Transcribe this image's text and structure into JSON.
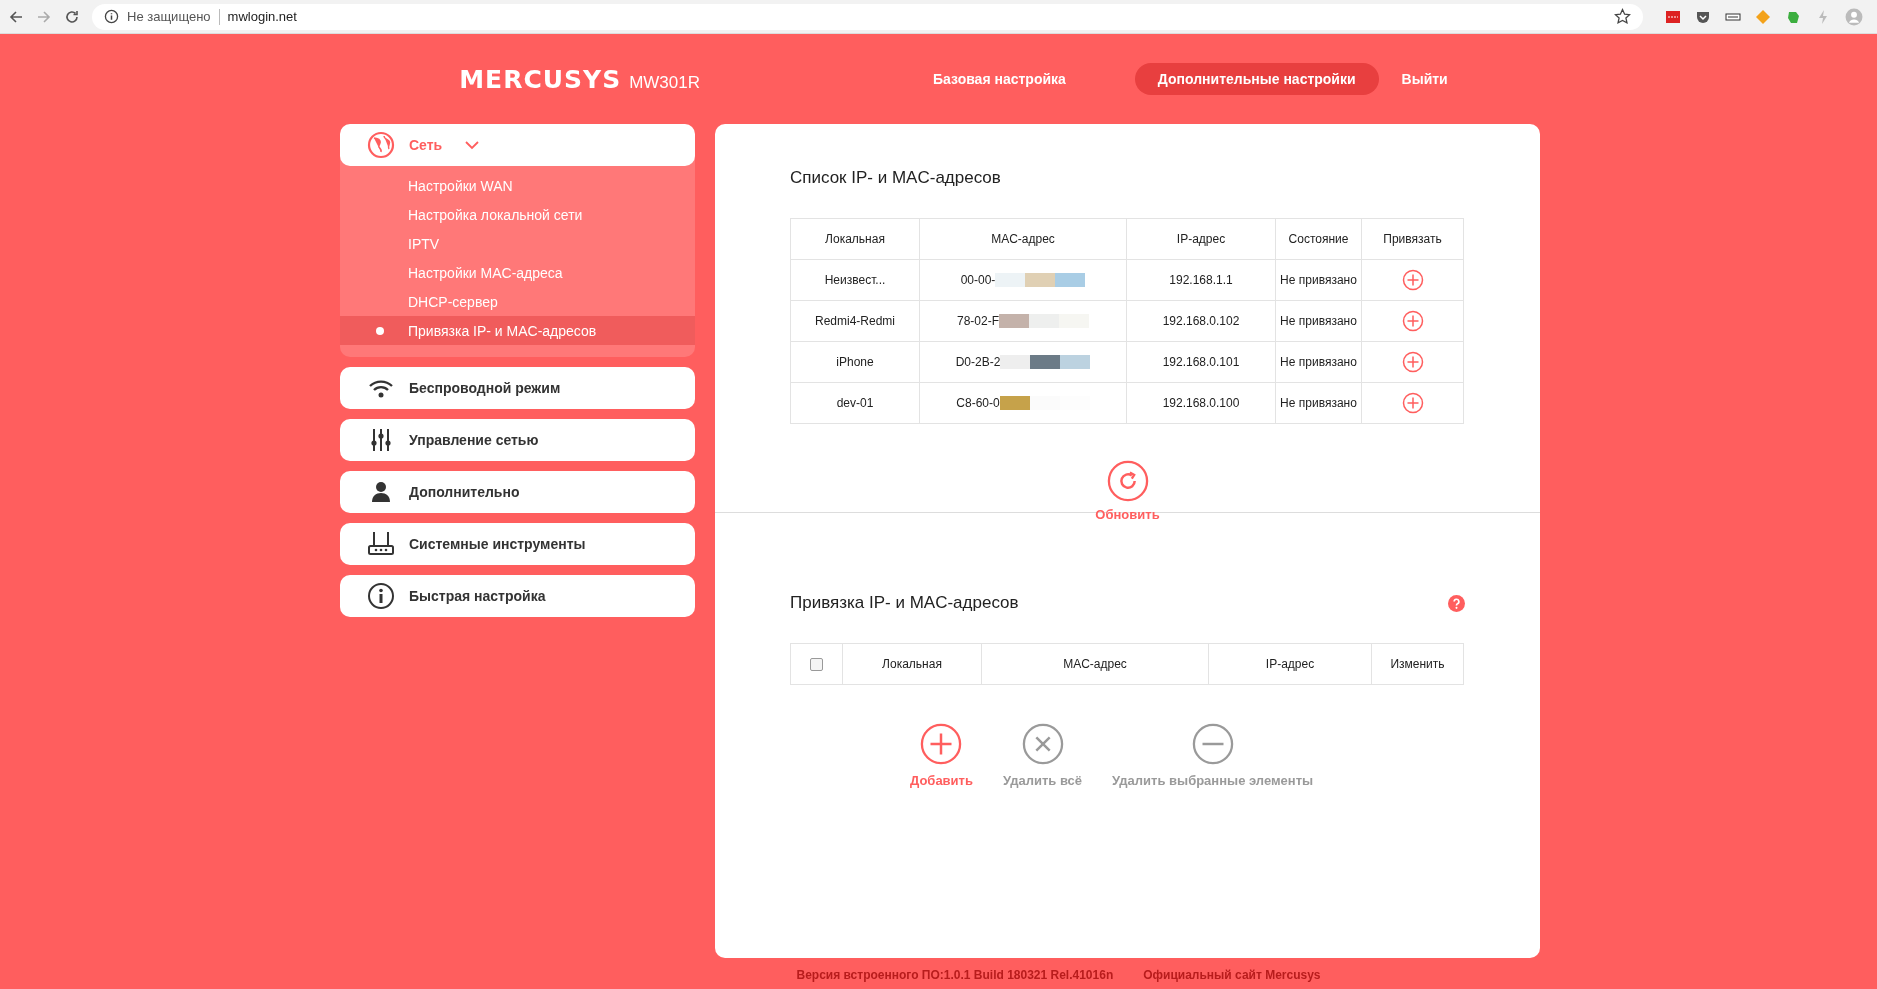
{
  "browser": {
    "security": "Не защищено",
    "url": "mwlogin.net"
  },
  "header": {
    "logo": "MERCUSYS",
    "model": "MW301R",
    "nav": [
      {
        "label": "Базовая настройка",
        "selected": false
      },
      {
        "label": "Дополнительные настройки",
        "selected": true
      },
      {
        "label": "Выйти",
        "selected": false
      }
    ]
  },
  "sidebar": {
    "items": [
      {
        "label": "Сеть",
        "expanded": true,
        "children": [
          {
            "label": "Настройки WAN",
            "selected": false
          },
          {
            "label": "Настройка локальной сети",
            "selected": false
          },
          {
            "label": "IPTV",
            "selected": false
          },
          {
            "label": "Настройки MAC-адреса",
            "selected": false
          },
          {
            "label": "DHCP-сервер",
            "selected": false
          },
          {
            "label": "Привязка IP- и MAC-адресов",
            "selected": true
          }
        ]
      },
      {
        "label": "Беспроводной режим",
        "expanded": false
      },
      {
        "label": "Управление сетью",
        "expanded": false
      },
      {
        "label": "Дополнительно",
        "expanded": false
      },
      {
        "label": "Системные инструменты",
        "expanded": false
      },
      {
        "label": "Быстрая настройка",
        "expanded": false
      }
    ]
  },
  "arp_list": {
    "title": "Список IP- и MAC-адресов",
    "columns": [
      "Локальная",
      "MAC-адрес",
      "IP-адрес",
      "Состояние",
      "Привязать"
    ],
    "rows": [
      {
        "name": "Неизвест...",
        "mac": "00-00-",
        "ip": "192.168.1.1",
        "status": "Не привязано"
      },
      {
        "name": "Redmi4-Redmi",
        "mac": "78-02-F",
        "ip": "192.168.0.102",
        "status": "Не привязано"
      },
      {
        "name": "iPhone",
        "mac": "D0-2B-2",
        "ip": "192.168.0.101",
        "status": "Не привязано"
      },
      {
        "name": "dev-01",
        "mac": "C8-60-0",
        "ip": "192.168.0.100",
        "status": "Не привязано"
      }
    ],
    "refresh": "Обновить"
  },
  "binding": {
    "title": "Привязка IP- и MAC-адресов",
    "select_all_checked": false,
    "columns": [
      "Локальная",
      "MAC-адрес",
      "IP-адрес",
      "Изменить"
    ],
    "actions": [
      {
        "label": "Добавить",
        "kind": "add"
      },
      {
        "label": "Удалить всё",
        "kind": "delete"
      },
      {
        "label": "Удалить выбранные элементы",
        "kind": "remove"
      }
    ]
  },
  "footer": {
    "firmware": "Версия встроенного ПО:1.0.1 Build 180321 Rel.41016n",
    "site_link": "Официальный сайт Mercusys"
  }
}
